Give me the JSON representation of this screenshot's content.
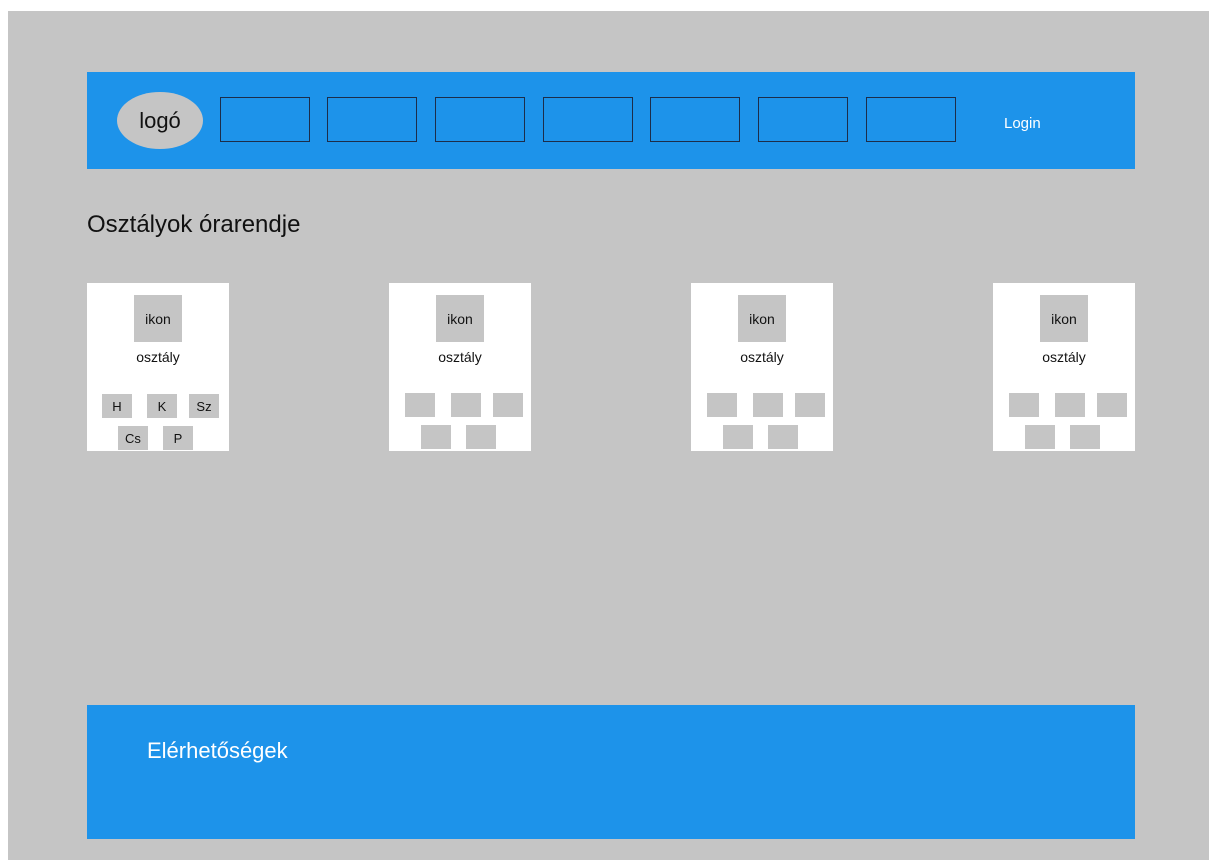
{
  "header": {
    "logo_text": "logó",
    "nav_items": [
      "",
      "",
      "",
      "",
      "",
      "",
      ""
    ],
    "login_label": "Login"
  },
  "main": {
    "title": "Osztályok órarendje",
    "cards": [
      {
        "icon_label": "ikon",
        "name": "osztály",
        "days": [
          "H",
          "K",
          "Sz",
          "Cs",
          "P"
        ]
      },
      {
        "icon_label": "ikon",
        "name": "osztály",
        "days": [
          "",
          "",
          "",
          "",
          ""
        ]
      },
      {
        "icon_label": "ikon",
        "name": "osztály",
        "days": [
          "",
          "",
          "",
          "",
          ""
        ]
      },
      {
        "icon_label": "ikon",
        "name": "osztály",
        "days": [
          "",
          "",
          "",
          "",
          ""
        ]
      }
    ]
  },
  "footer": {
    "title": "Elérhetőségek"
  },
  "colors": {
    "background": "#c5c5c5",
    "accent_blue": "#1d93ea",
    "card": "#ffffff"
  }
}
